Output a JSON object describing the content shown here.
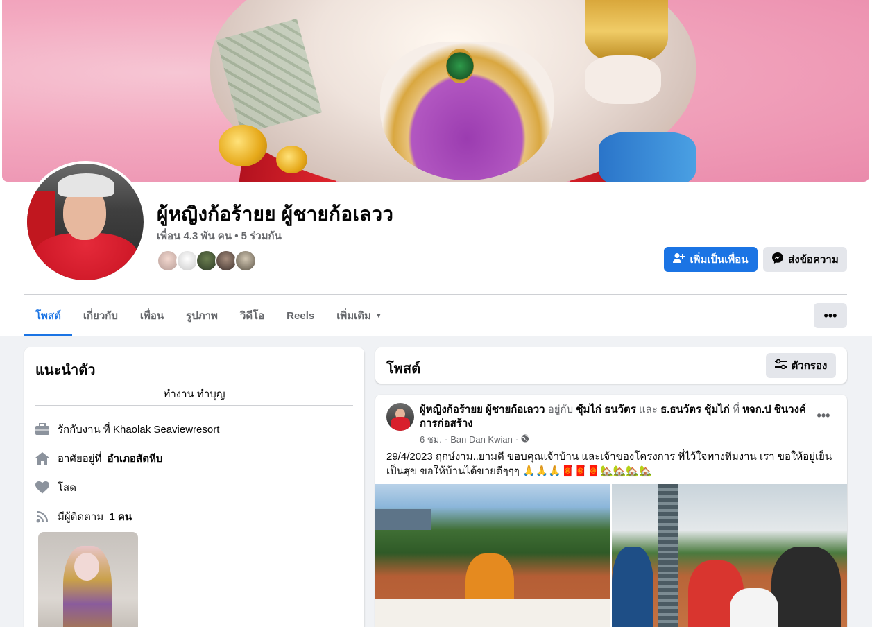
{
  "profile": {
    "name": "ผู้หญิงก้อร้ายย ผู้ชายก้อเลวว",
    "friend_meta": "เพื่อน 4.3 พัน คน • 5 ร่วมกัน",
    "add_friend_label": "เพิ่มเป็นเพื่อน",
    "message_label": "ส่งข้อความ"
  },
  "tabs": [
    {
      "label": "โพสต์",
      "active": true
    },
    {
      "label": "เกี่ยวกับ"
    },
    {
      "label": "เพื่อน"
    },
    {
      "label": "รูปภาพ"
    },
    {
      "label": "วิดีโอ"
    },
    {
      "label": "Reels"
    },
    {
      "label": "เพิ่มเติม"
    }
  ],
  "more_menu_label": "•••",
  "intro": {
    "title": "แนะนำตัว",
    "bio": "ทำงาน ทำบุญ",
    "work_prefix": "รักกับงาน ที่",
    "work_place": "Khaolak Seaviewresort",
    "lives_prefix": "อาศัยอยู่ที่",
    "lives_place": "อำเภอสัตหีบ",
    "relationship": "โสด",
    "followers_prefix": "มีผู้ติดตาม",
    "followers_count": "1 คน"
  },
  "posts_header": {
    "title": "โพสต์",
    "filter_label": "ตัวกรอง"
  },
  "post": {
    "author": "ผู้หญิงก้อร้ายย ผู้ชายก้อเลวว",
    "with_word": "อยู่กับ",
    "tag1": "ชุ้มไก่ ธนวัตร",
    "and_word": "และ",
    "tag2": "ธ.ธนวัตร ชุ้มไก่",
    "at_word": "ที่",
    "location": "หจก.ป ชินวงค์การก่อสร้าง",
    "time": "6 ชม.",
    "place": "Ban Dan Kwian",
    "text": "29/4/2023 ฤกษ์งาม..ยามดี  ขอบคุณเจ้าบ้าน และเจ้าของโครงการ ที่ไว้ใจทางทีมงาน เรา  ขอให้อยู่เย็นเป็นสุข ขอให้บ้านได้ขายดีๆๆๆ    🙏🙏🙏🧧🧧🧧🏡🏡🏡🏡"
  },
  "colors": {
    "accent": "#1b74e4",
    "muted_text": "#65676b",
    "page_bg": "#f0f2f5",
    "button_gray": "#e4e6eb"
  }
}
